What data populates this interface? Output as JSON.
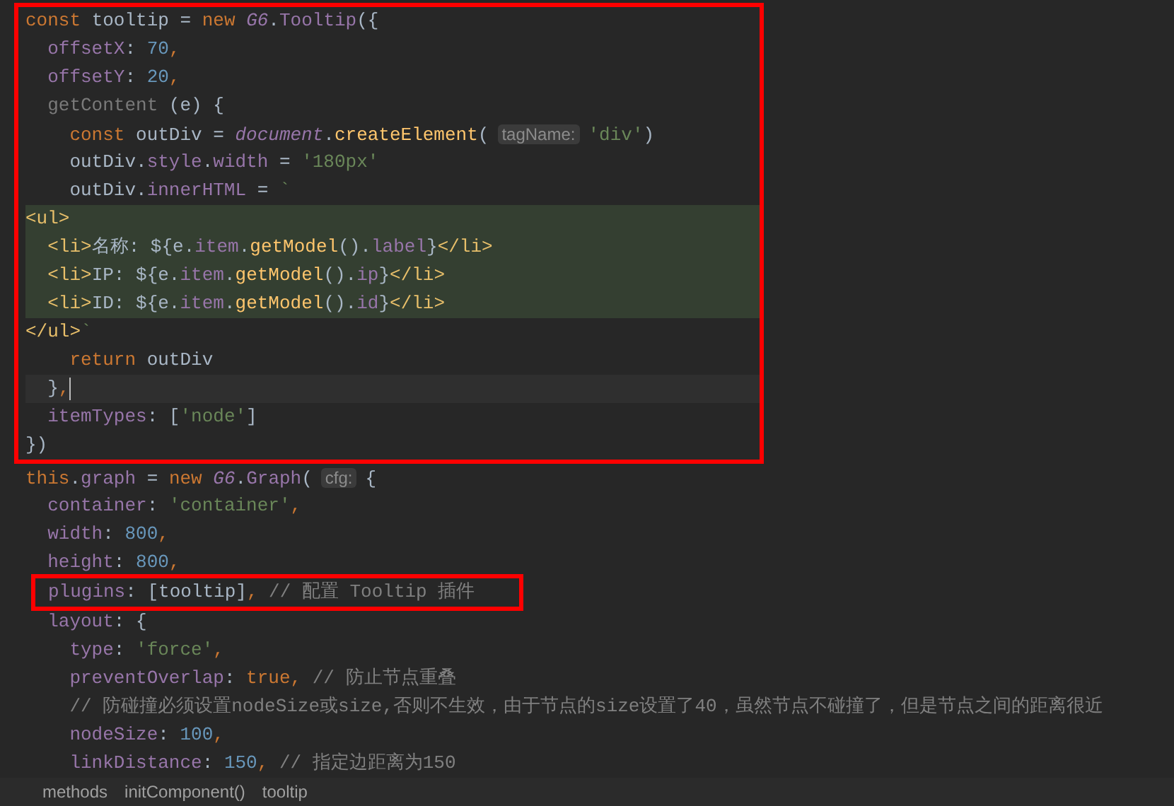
{
  "editor": {
    "blocks": [
      {
        "kind": "wide-box",
        "lines": [
          {
            "tokens": [
              {
                "kind": "kw",
                "text": "const"
              },
              {
                "kind": "txt",
                "text": " tooltip = "
              },
              {
                "kind": "kw",
                "text": "new "
              },
              {
                "kind": "cls",
                "text": "G6"
              },
              {
                "kind": "txt",
                "text": "."
              },
              {
                "kind": "prop",
                "text": "Tooltip"
              },
              {
                "kind": "txt",
                "text": "({"
              }
            ]
          },
          {
            "tokens": [
              {
                "kind": "prop",
                "text": "  offsetX"
              },
              {
                "kind": "txt",
                "text": ": "
              },
              {
                "kind": "num",
                "text": "70"
              },
              {
                "kind": "kw",
                "text": ","
              }
            ]
          },
          {
            "tokens": [
              {
                "kind": "prop",
                "text": "  offsetY"
              },
              {
                "kind": "txt",
                "text": ": "
              },
              {
                "kind": "num",
                "text": "20"
              },
              {
                "kind": "kw",
                "text": ","
              }
            ]
          },
          {
            "tokens": [
              {
                "kind": "dim",
                "text": "  getContent"
              },
              {
                "kind": "txt",
                "text": " (e) {"
              }
            ]
          },
          {
            "tokens": [
              {
                "kind": "kw",
                "text": "    const"
              },
              {
                "kind": "txt",
                "text": " outDiv = "
              },
              {
                "kind": "cls",
                "text": "document"
              },
              {
                "kind": "txt",
                "text": "."
              },
              {
                "kind": "fn",
                "text": "createElement"
              },
              {
                "kind": "txt",
                "text": "("
              },
              {
                "kind": "hint",
                "text": "tagName:"
              },
              {
                "kind": "str",
                "text": "'div'"
              },
              {
                "kind": "txt",
                "text": ")"
              }
            ]
          },
          {
            "tokens": [
              {
                "kind": "txt",
                "text": "    outDiv."
              },
              {
                "kind": "prop",
                "text": "style"
              },
              {
                "kind": "txt",
                "text": "."
              },
              {
                "kind": "prop",
                "text": "width"
              },
              {
                "kind": "txt",
                "text": " = "
              },
              {
                "kind": "str",
                "text": "'180px'"
              }
            ]
          },
          {
            "tokens": [
              {
                "kind": "txt",
                "text": "    outDiv."
              },
              {
                "kind": "prop",
                "text": "innerHTML"
              },
              {
                "kind": "txt",
                "text": " = "
              },
              {
                "kind": "str",
                "text": "`"
              }
            ]
          },
          {
            "highlighted": true,
            "tokens": [
              {
                "kind": "tag",
                "text": "<ul>"
              }
            ]
          },
          {
            "highlighted": true,
            "tokens": [
              {
                "kind": "tag",
                "text": "  <li>"
              },
              {
                "kind": "txt",
                "text": "名称: ${e."
              },
              {
                "kind": "prop",
                "text": "item"
              },
              {
                "kind": "txt",
                "text": "."
              },
              {
                "kind": "fn",
                "text": "getModel"
              },
              {
                "kind": "txt",
                "text": "()."
              },
              {
                "kind": "prop",
                "text": "label"
              },
              {
                "kind": "txt",
                "text": "}"
              },
              {
                "kind": "tag",
                "text": "</li>"
              }
            ]
          },
          {
            "highlighted": true,
            "tokens": [
              {
                "kind": "tag",
                "text": "  <li>"
              },
              {
                "kind": "txt",
                "text": "IP: ${e."
              },
              {
                "kind": "prop",
                "text": "item"
              },
              {
                "kind": "txt",
                "text": "."
              },
              {
                "kind": "fn",
                "text": "getModel"
              },
              {
                "kind": "txt",
                "text": "()."
              },
              {
                "kind": "prop",
                "text": "ip"
              },
              {
                "kind": "txt",
                "text": "}"
              },
              {
                "kind": "tag",
                "text": "</li>"
              }
            ]
          },
          {
            "highlighted": true,
            "tokens": [
              {
                "kind": "tag",
                "text": "  <li>"
              },
              {
                "kind": "txt",
                "text": "ID: ${e."
              },
              {
                "kind": "prop",
                "text": "item"
              },
              {
                "kind": "txt",
                "text": "."
              },
              {
                "kind": "fn",
                "text": "getModel"
              },
              {
                "kind": "txt",
                "text": "()."
              },
              {
                "kind": "prop",
                "text": "id"
              },
              {
                "kind": "txt",
                "text": "}"
              },
              {
                "kind": "tag",
                "text": "</li>"
              }
            ]
          },
          {
            "tokens": [
              {
                "kind": "tag",
                "text": "</ul>"
              },
              {
                "kind": "str",
                "text": "`"
              }
            ]
          },
          {
            "tokens": [
              {
                "kind": "kw",
                "text": "    return"
              },
              {
                "kind": "txt",
                "text": " outDiv"
              }
            ]
          },
          {
            "current": true,
            "tokens": [
              {
                "kind": "txt",
                "text": "  }"
              },
              {
                "kind": "kw",
                "text": ","
              }
            ]
          },
          {
            "tokens": [
              {
                "kind": "prop",
                "text": "  itemTypes"
              },
              {
                "kind": "txt",
                "text": ": ["
              },
              {
                "kind": "str",
                "text": "'node'"
              },
              {
                "kind": "txt",
                "text": "]"
              }
            ]
          },
          {
            "tokens": [
              {
                "kind": "txt",
                "text": "})"
              }
            ]
          }
        ]
      },
      {
        "kind": "plain",
        "lines": [
          {
            "tokens": [
              {
                "kind": "kw",
                "text": "this"
              },
              {
                "kind": "txt",
                "text": "."
              },
              {
                "kind": "prop",
                "text": "graph"
              },
              {
                "kind": "txt",
                "text": " = "
              },
              {
                "kind": "kw",
                "text": "new "
              },
              {
                "kind": "cls",
                "text": "G6"
              },
              {
                "kind": "txt",
                "text": "."
              },
              {
                "kind": "prop",
                "text": "Graph"
              },
              {
                "kind": "txt",
                "text": "("
              },
              {
                "kind": "hint",
                "text": "cfg:"
              },
              {
                "kind": "txt",
                "text": "{"
              }
            ]
          },
          {
            "tokens": [
              {
                "kind": "prop",
                "text": "  container"
              },
              {
                "kind": "txt",
                "text": ": "
              },
              {
                "kind": "str",
                "text": "'container'"
              },
              {
                "kind": "kw",
                "text": ","
              }
            ]
          },
          {
            "tokens": [
              {
                "kind": "prop",
                "text": "  width"
              },
              {
                "kind": "txt",
                "text": ": "
              },
              {
                "kind": "num",
                "text": "800"
              },
              {
                "kind": "kw",
                "text": ","
              }
            ]
          },
          {
            "tokens": [
              {
                "kind": "prop",
                "text": "  height"
              },
              {
                "kind": "txt",
                "text": ": "
              },
              {
                "kind": "num",
                "text": "800"
              },
              {
                "kind": "kw",
                "text": ","
              }
            ]
          }
        ]
      },
      {
        "kind": "tight-box",
        "lines": [
          {
            "tokens": [
              {
                "kind": "prop",
                "text": "plugins"
              },
              {
                "kind": "txt",
                "text": ": [tooltip]"
              },
              {
                "kind": "kw",
                "text": ", "
              },
              {
                "kind": "cmt",
                "text": "// 配置 Tooltip 插件"
              }
            ]
          }
        ]
      },
      {
        "kind": "plain",
        "lines": [
          {
            "tokens": [
              {
                "kind": "prop",
                "text": "  layout"
              },
              {
                "kind": "txt",
                "text": ": {"
              }
            ]
          },
          {
            "tokens": [
              {
                "kind": "prop",
                "text": "    type"
              },
              {
                "kind": "txt",
                "text": ": "
              },
              {
                "kind": "str",
                "text": "'force'"
              },
              {
                "kind": "kw",
                "text": ","
              }
            ]
          },
          {
            "tokens": [
              {
                "kind": "prop",
                "text": "    preventOverlap"
              },
              {
                "kind": "txt",
                "text": ": "
              },
              {
                "kind": "kw",
                "text": "true, "
              },
              {
                "kind": "cmt",
                "text": "// 防止节点重叠"
              }
            ]
          },
          {
            "tokens": [
              {
                "kind": "cmt",
                "text": "    // 防碰撞必须设置nodeSize或size,否则不生效，由于节点的size设置了40，虽然节点不碰撞了，但是节点之间的距离很近"
              }
            ]
          },
          {
            "tokens": [
              {
                "kind": "prop",
                "text": "    nodeSize"
              },
              {
                "kind": "txt",
                "text": ": "
              },
              {
                "kind": "num",
                "text": "100"
              },
              {
                "kind": "kw",
                "text": ","
              }
            ]
          },
          {
            "tokens": [
              {
                "kind": "prop",
                "text": "    linkDistance"
              },
              {
                "kind": "txt",
                "text": ": "
              },
              {
                "kind": "num",
                "text": "150"
              },
              {
                "kind": "kw",
                "text": ", "
              },
              {
                "kind": "cmt",
                "text": "// 指定边距离为150"
              }
            ]
          }
        ]
      }
    ]
  },
  "breadcrumb": [
    "methods",
    "initComponent()",
    "tooltip"
  ]
}
